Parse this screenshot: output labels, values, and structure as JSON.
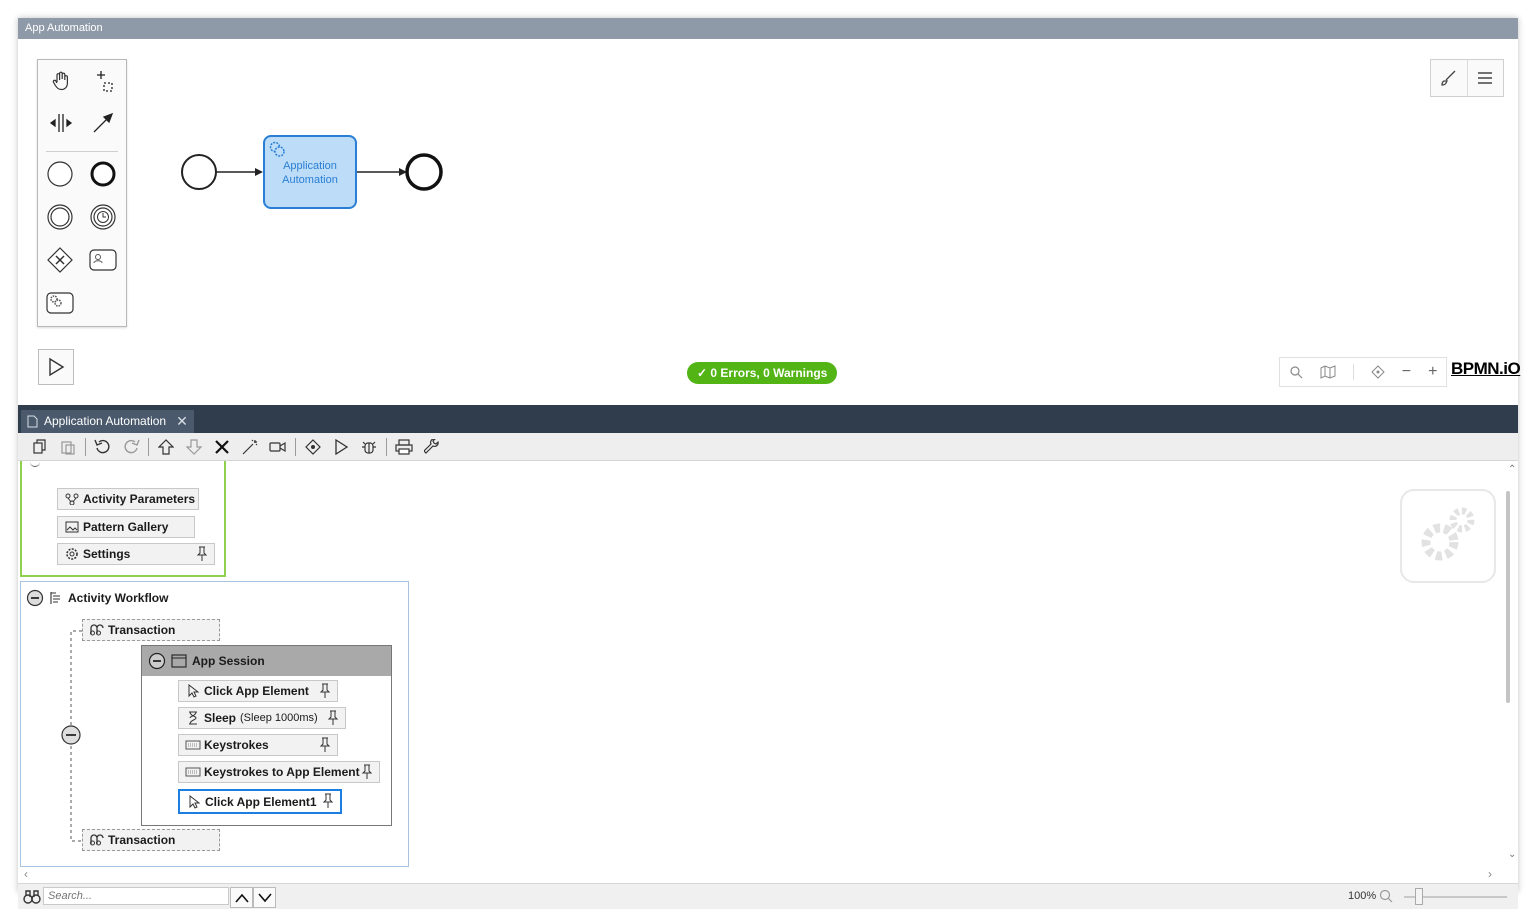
{
  "window": {
    "title": "App Automation"
  },
  "diagram": {
    "task_label_line1": "Application",
    "task_label_line2": "Automation",
    "status": "0 Errors, 0 Warnings",
    "logo": "BPMN.iO",
    "palette_tools": [
      "hand-tool-icon",
      "lasso-tool-icon",
      "space-tool-icon",
      "connect-tool-icon",
      "start-event-icon",
      "end-event-icon",
      "intermediate-event-icon",
      "timer-event-icon",
      "gateway-icon",
      "user-task-icon",
      "service-task-icon"
    ],
    "zoom_controls": [
      "search-icon",
      "map-icon",
      "reset-icon",
      "zoom-out-icon",
      "zoom-in-icon"
    ]
  },
  "document_tab": {
    "label": "Application Automation"
  },
  "toolbar": {
    "buttons": [
      "copy-icon",
      "paste-icon",
      "undo-icon",
      "redo-icon",
      "move-up-icon",
      "move-down-icon",
      "delete-icon",
      "magic-wand-icon",
      "record-icon",
      "debug-icon",
      "run-icon",
      "bug-icon",
      "print-icon",
      "wrench-icon"
    ]
  },
  "tree": {
    "activity_parameters": "Activity Parameters",
    "pattern_gallery": "Pattern Gallery",
    "settings": "Settings",
    "activity_workflow": "Activity Workflow",
    "transaction_top": "Transaction",
    "app_session": "App Session",
    "steps": [
      {
        "label": "Click App Element",
        "detail": ""
      },
      {
        "label": "Sleep",
        "detail": "(Sleep 1000ms)"
      },
      {
        "label": "Keystrokes",
        "detail": ""
      },
      {
        "label": "Keystrokes to App Element",
        "detail": ""
      },
      {
        "label": "Click App Element1",
        "detail": ""
      }
    ],
    "transaction_bottom": "Transaction"
  },
  "statusbar": {
    "search_placeholder": "Search...",
    "zoom": "100%"
  },
  "colors": {
    "status_green": "#52b415",
    "task_fill": "#bcdcf7",
    "task_border": "#2a7fd4",
    "tabstrip": "#2f3d4d",
    "group_green": "#8fd14f"
  }
}
